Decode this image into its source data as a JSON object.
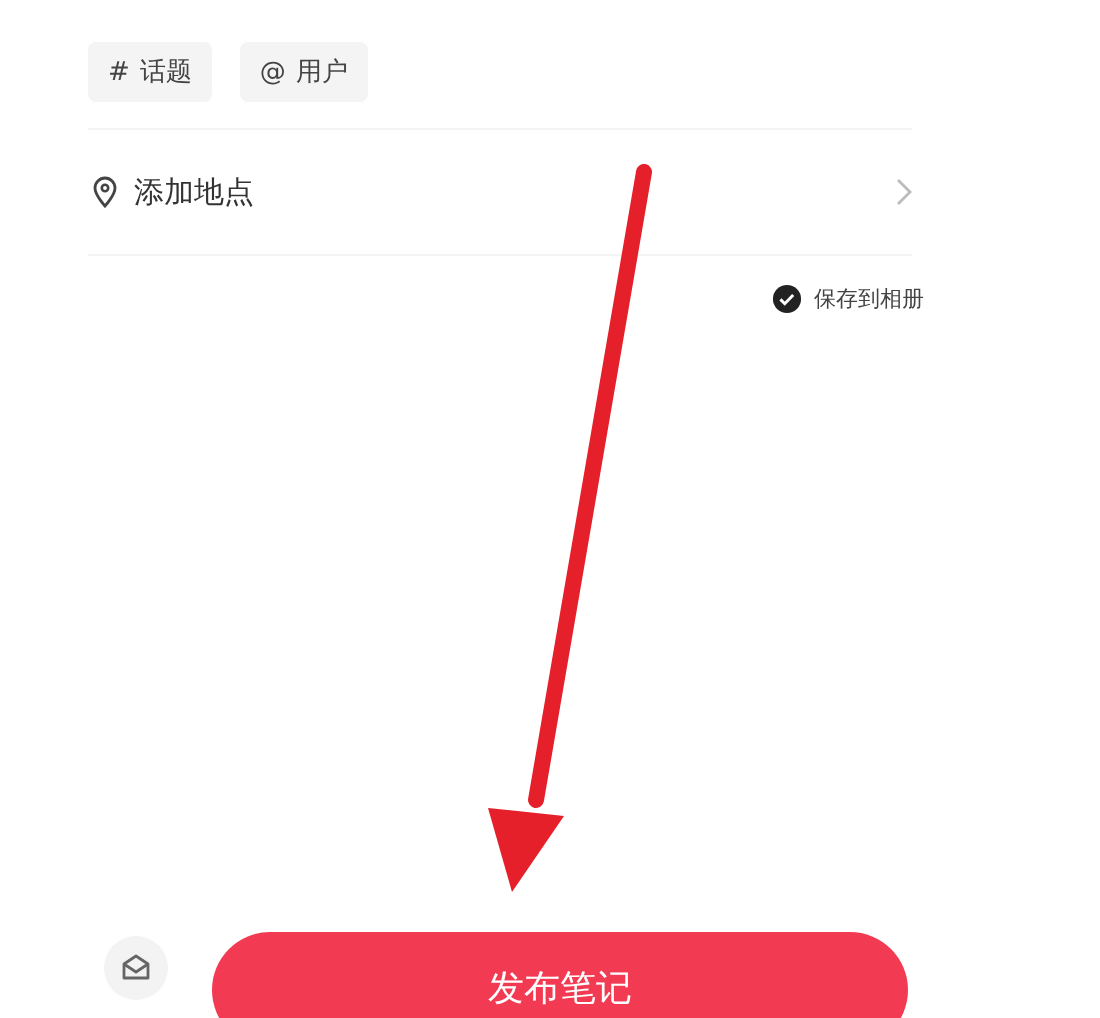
{
  "tags": [
    {
      "symbol": "#",
      "label": "话题"
    },
    {
      "symbol": "@",
      "label": "用户"
    }
  ],
  "location": {
    "label": "添加地点"
  },
  "save_to_album": {
    "label": "保存到相册",
    "checked": true
  },
  "publish_button": {
    "label": "发布笔记"
  }
}
